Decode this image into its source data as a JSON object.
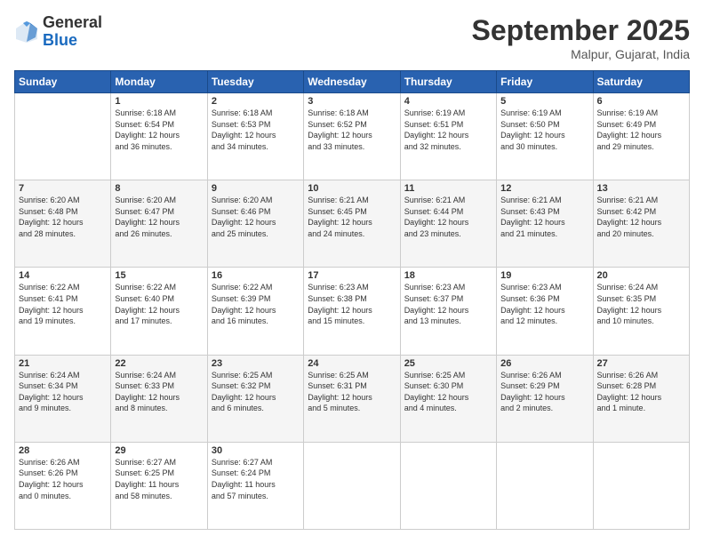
{
  "header": {
    "logo": {
      "general": "General",
      "blue": "Blue"
    },
    "title": "September 2025",
    "location": "Malpur, Gujarat, India"
  },
  "calendar": {
    "days_of_week": [
      "Sunday",
      "Monday",
      "Tuesday",
      "Wednesday",
      "Thursday",
      "Friday",
      "Saturday"
    ],
    "weeks": [
      [
        {
          "day": "",
          "info": ""
        },
        {
          "day": "1",
          "info": "Sunrise: 6:18 AM\nSunset: 6:54 PM\nDaylight: 12 hours\nand 36 minutes."
        },
        {
          "day": "2",
          "info": "Sunrise: 6:18 AM\nSunset: 6:53 PM\nDaylight: 12 hours\nand 34 minutes."
        },
        {
          "day": "3",
          "info": "Sunrise: 6:18 AM\nSunset: 6:52 PM\nDaylight: 12 hours\nand 33 minutes."
        },
        {
          "day": "4",
          "info": "Sunrise: 6:19 AM\nSunset: 6:51 PM\nDaylight: 12 hours\nand 32 minutes."
        },
        {
          "day": "5",
          "info": "Sunrise: 6:19 AM\nSunset: 6:50 PM\nDaylight: 12 hours\nand 30 minutes."
        },
        {
          "day": "6",
          "info": "Sunrise: 6:19 AM\nSunset: 6:49 PM\nDaylight: 12 hours\nand 29 minutes."
        }
      ],
      [
        {
          "day": "7",
          "info": "Sunrise: 6:20 AM\nSunset: 6:48 PM\nDaylight: 12 hours\nand 28 minutes."
        },
        {
          "day": "8",
          "info": "Sunrise: 6:20 AM\nSunset: 6:47 PM\nDaylight: 12 hours\nand 26 minutes."
        },
        {
          "day": "9",
          "info": "Sunrise: 6:20 AM\nSunset: 6:46 PM\nDaylight: 12 hours\nand 25 minutes."
        },
        {
          "day": "10",
          "info": "Sunrise: 6:21 AM\nSunset: 6:45 PM\nDaylight: 12 hours\nand 24 minutes."
        },
        {
          "day": "11",
          "info": "Sunrise: 6:21 AM\nSunset: 6:44 PM\nDaylight: 12 hours\nand 23 minutes."
        },
        {
          "day": "12",
          "info": "Sunrise: 6:21 AM\nSunset: 6:43 PM\nDaylight: 12 hours\nand 21 minutes."
        },
        {
          "day": "13",
          "info": "Sunrise: 6:21 AM\nSunset: 6:42 PM\nDaylight: 12 hours\nand 20 minutes."
        }
      ],
      [
        {
          "day": "14",
          "info": "Sunrise: 6:22 AM\nSunset: 6:41 PM\nDaylight: 12 hours\nand 19 minutes."
        },
        {
          "day": "15",
          "info": "Sunrise: 6:22 AM\nSunset: 6:40 PM\nDaylight: 12 hours\nand 17 minutes."
        },
        {
          "day": "16",
          "info": "Sunrise: 6:22 AM\nSunset: 6:39 PM\nDaylight: 12 hours\nand 16 minutes."
        },
        {
          "day": "17",
          "info": "Sunrise: 6:23 AM\nSunset: 6:38 PM\nDaylight: 12 hours\nand 15 minutes."
        },
        {
          "day": "18",
          "info": "Sunrise: 6:23 AM\nSunset: 6:37 PM\nDaylight: 12 hours\nand 13 minutes."
        },
        {
          "day": "19",
          "info": "Sunrise: 6:23 AM\nSunset: 6:36 PM\nDaylight: 12 hours\nand 12 minutes."
        },
        {
          "day": "20",
          "info": "Sunrise: 6:24 AM\nSunset: 6:35 PM\nDaylight: 12 hours\nand 10 minutes."
        }
      ],
      [
        {
          "day": "21",
          "info": "Sunrise: 6:24 AM\nSunset: 6:34 PM\nDaylight: 12 hours\nand 9 minutes."
        },
        {
          "day": "22",
          "info": "Sunrise: 6:24 AM\nSunset: 6:33 PM\nDaylight: 12 hours\nand 8 minutes."
        },
        {
          "day": "23",
          "info": "Sunrise: 6:25 AM\nSunset: 6:32 PM\nDaylight: 12 hours\nand 6 minutes."
        },
        {
          "day": "24",
          "info": "Sunrise: 6:25 AM\nSunset: 6:31 PM\nDaylight: 12 hours\nand 5 minutes."
        },
        {
          "day": "25",
          "info": "Sunrise: 6:25 AM\nSunset: 6:30 PM\nDaylight: 12 hours\nand 4 minutes."
        },
        {
          "day": "26",
          "info": "Sunrise: 6:26 AM\nSunset: 6:29 PM\nDaylight: 12 hours\nand 2 minutes."
        },
        {
          "day": "27",
          "info": "Sunrise: 6:26 AM\nSunset: 6:28 PM\nDaylight: 12 hours\nand 1 minute."
        }
      ],
      [
        {
          "day": "28",
          "info": "Sunrise: 6:26 AM\nSunset: 6:26 PM\nDaylight: 12 hours\nand 0 minutes."
        },
        {
          "day": "29",
          "info": "Sunrise: 6:27 AM\nSunset: 6:25 PM\nDaylight: 11 hours\nand 58 minutes."
        },
        {
          "day": "30",
          "info": "Sunrise: 6:27 AM\nSunset: 6:24 PM\nDaylight: 11 hours\nand 57 minutes."
        },
        {
          "day": "",
          "info": ""
        },
        {
          "day": "",
          "info": ""
        },
        {
          "day": "",
          "info": ""
        },
        {
          "day": "",
          "info": ""
        }
      ]
    ]
  }
}
